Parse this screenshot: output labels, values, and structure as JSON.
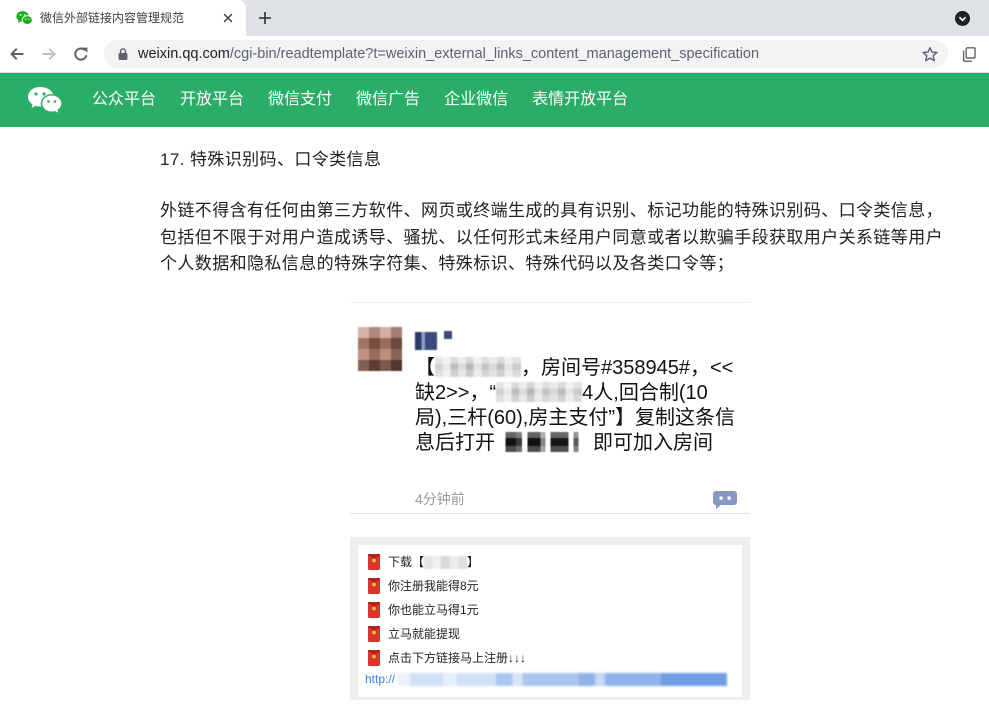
{
  "browser": {
    "tab": {
      "title": "微信外部链接内容管理规范"
    },
    "url": {
      "domain": "weixin.qq.com",
      "path": "/cgi-bin/readtemplate?t=weixin_external_links_content_management_specification"
    },
    "icons": {
      "favicon": "wechat-favicon-icon",
      "tab_close": "close-icon",
      "new_tab": "plus-icon",
      "tab_search": "chevron-down-circle-icon",
      "back": "back-arrow-icon",
      "forward": "forward-arrow-icon",
      "reload": "reload-icon",
      "security": "lock-icon",
      "bookmark": "star-icon",
      "extension": "copy-icon"
    }
  },
  "site_nav": {
    "background": "#2aae67",
    "logo_icon": "wechat-logo-icon",
    "items": [
      "公众平台",
      "开放平台",
      "微信支付",
      "微信广告",
      "企业微信",
      "表情开放平台"
    ]
  },
  "article": {
    "heading": "17. 特殊识别码、口令类信息",
    "body": "外链不得含有任何由第三方软件、网页或终端生成的具有识别、标记功能的特殊识别码、口令类信息，包括但不限于对用户造成诱导、骚扰、以任何形式未经用户同意或者以欺骗手段获取用户关系链等用户个人数据和隐私信息的特殊字符集、特殊标识、特殊代码以及各类口令等；"
  },
  "example_chat": {
    "message": {
      "open": "【",
      "segment_1": "，房间号#358945#，<<缺2>>，“",
      "segment_2": "4人,回合制(10局),三杆(60),房主支付”】复制这条信息后打开",
      "segment_3": "即可加入房间"
    },
    "time": "4分钟前",
    "comment_icon": "comment-icon"
  },
  "example_list": {
    "item_icon": "red-packet-icon",
    "download_open": "下载【",
    "download_close": "】",
    "items": [
      "你注册我能得8元",
      "你也能立马得1元",
      "立马就能提现",
      "点击下方链接马上注册↓↓↓"
    ],
    "link_prefix": "http://",
    "link_color": "#3f7fd8"
  }
}
